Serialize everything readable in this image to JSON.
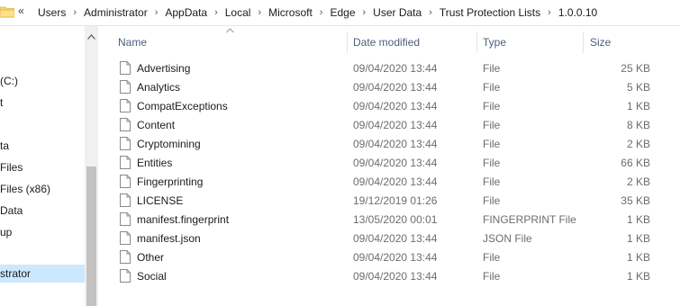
{
  "address": {
    "overflow_glyph": "«",
    "crumbs": [
      "Users",
      "Administrator",
      "AppData",
      "Local",
      "Microsoft",
      "Edge",
      "User Data",
      "Trust Protection Lists",
      "1.0.0.10"
    ],
    "separator": "›"
  },
  "nav": {
    "items": [
      {
        "label": "(C:)"
      },
      {
        "label": "t"
      },
      {
        "label": "ta"
      },
      {
        "label": "Files"
      },
      {
        "label": "Files (x86)"
      },
      {
        "label": "Data"
      },
      {
        "label": "up"
      },
      {
        "label": "strator",
        "selected": true
      }
    ]
  },
  "columns": {
    "name": "Name",
    "date": "Date modified",
    "type": "Type",
    "size": "Size",
    "sort_indicator": "^"
  },
  "files": [
    {
      "name": "Advertising",
      "date": "09/04/2020 13:44",
      "type": "File",
      "size": "25 KB"
    },
    {
      "name": "Analytics",
      "date": "09/04/2020 13:44",
      "type": "File",
      "size": "5 KB"
    },
    {
      "name": "CompatExceptions",
      "date": "09/04/2020 13:44",
      "type": "File",
      "size": "1 KB"
    },
    {
      "name": "Content",
      "date": "09/04/2020 13:44",
      "type": "File",
      "size": "8 KB"
    },
    {
      "name": "Cryptomining",
      "date": "09/04/2020 13:44",
      "type": "File",
      "size": "2 KB"
    },
    {
      "name": "Entities",
      "date": "09/04/2020 13:44",
      "type": "File",
      "size": "66 KB"
    },
    {
      "name": "Fingerprinting",
      "date": "09/04/2020 13:44",
      "type": "File",
      "size": "2 KB"
    },
    {
      "name": "LICENSE",
      "date": "19/12/2019 01:26",
      "type": "File",
      "size": "35 KB"
    },
    {
      "name": "manifest.fingerprint",
      "date": "13/05/2020 00:01",
      "type": "FINGERPRINT File",
      "size": "1 KB"
    },
    {
      "name": "manifest.json",
      "date": "09/04/2020 13:44",
      "type": "JSON File",
      "size": "1 KB"
    },
    {
      "name": "Other",
      "date": "09/04/2020 13:44",
      "type": "File",
      "size": "1 KB"
    },
    {
      "name": "Social",
      "date": "09/04/2020 13:44",
      "type": "File",
      "size": "1 KB"
    }
  ],
  "icons": {
    "folder": "folder-icon",
    "file": "file-icon",
    "scroll_up": "chevron-up-icon"
  },
  "colors": {
    "header_text": "#4c607a",
    "secondary_text": "#6d6d6d",
    "selection": "#cce8ff",
    "folder_yellow": "#f8d775"
  }
}
